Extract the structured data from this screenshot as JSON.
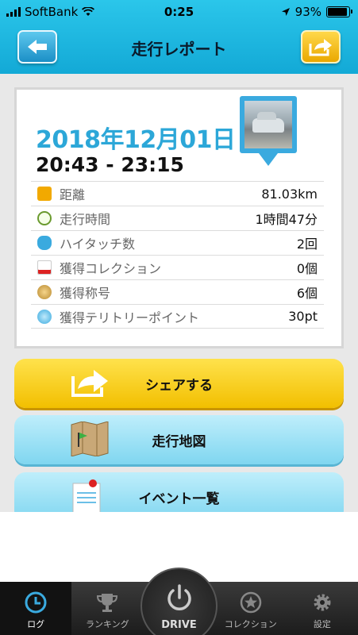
{
  "status": {
    "carrier": "SoftBank",
    "time": "0:25",
    "battery": "93%",
    "battery_level": 0.93
  },
  "header": {
    "title": "走行レポート",
    "back_icon": "arrow-left-icon",
    "share_icon": "share-arrow-icon"
  },
  "report": {
    "date": "2018年12月01日",
    "time_range": "20:43 - 23:15",
    "stats": [
      {
        "label": "距離",
        "value": "81.03km",
        "icon": "km-icon"
      },
      {
        "label": "走行時間",
        "value": "1時間47分",
        "icon": "clock-icon"
      },
      {
        "label": "ハイタッチ数",
        "value": "2回",
        "icon": "hand-icon"
      },
      {
        "label": "獲得コレクション",
        "value": "0個",
        "icon": "car-icon"
      },
      {
        "label": "獲得称号",
        "value": "6個",
        "icon": "medal-icon"
      },
      {
        "label": "獲得テリトリーポイント",
        "value": "30pt",
        "icon": "territory-icon"
      }
    ]
  },
  "buttons": {
    "share": "シェアする",
    "map": "走行地図",
    "events": "イベント一覧"
  },
  "tabs": [
    {
      "label": "ログ",
      "icon": "clock-icon"
    },
    {
      "label": "ランキング",
      "icon": "trophy-icon"
    },
    {
      "label": "DRIVE",
      "icon": "power-icon"
    },
    {
      "label": "コレクション",
      "icon": "star-icon"
    },
    {
      "label": "設定",
      "icon": "gear-icon"
    }
  ]
}
